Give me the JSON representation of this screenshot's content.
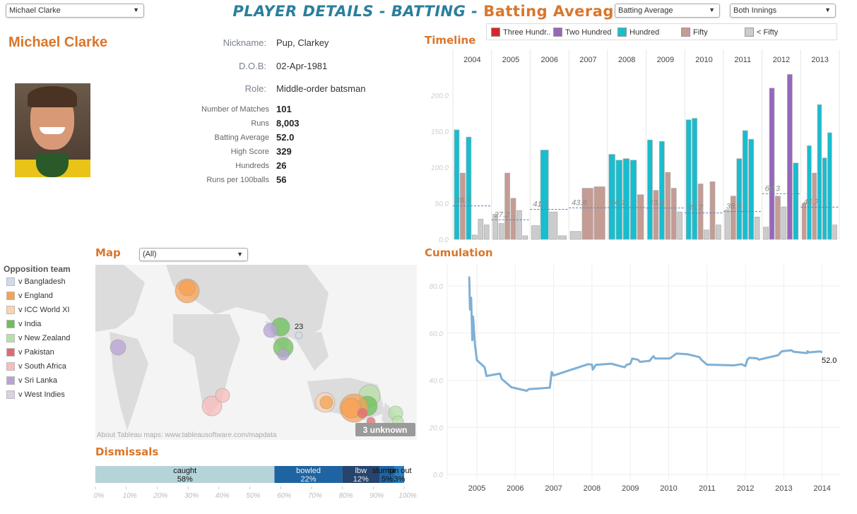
{
  "header": {
    "player_select": "Michael Clarke",
    "title_main": "PLAYER DETAILS - BATTING - ",
    "title_metric": "Batting Average",
    "metric_select": "Batting Average",
    "innings_select": "Both Innings"
  },
  "player": {
    "name": "Michael Clarke",
    "nickname_label": "Nickname:",
    "nickname": "Pup, Clarkey",
    "dob_label": "D.O.B:",
    "dob": "02-Apr-1981",
    "role_label": "Role:",
    "role": "Middle-order batsman",
    "stats": [
      {
        "label": "Number of Matches",
        "value": "101"
      },
      {
        "label": "Runs",
        "value": "8,003"
      },
      {
        "label": "Batting Average",
        "value": "52.0"
      },
      {
        "label": "High Score",
        "value": "329"
      },
      {
        "label": "Hundreds",
        "value": "26"
      },
      {
        "label": "Runs per 100balls",
        "value": "56"
      }
    ]
  },
  "timeline": {
    "title": "Timeline",
    "legend": [
      {
        "label": "Three Hundr..",
        "color": "#d62728"
      },
      {
        "label": "Two Hundred",
        "color": "#9467bd"
      },
      {
        "label": "Hundred",
        "color": "#17becf"
      },
      {
        "label": "Fifty",
        "color": "#c49c94"
      },
      {
        "label": "< Fifty",
        "color": "#cccccc"
      }
    ]
  },
  "map": {
    "title": "Map",
    "filter": "(All)",
    "attribution": "About Tableau maps: www.tableausoftware.com/mapdata",
    "unknown_badge": "3 unknown",
    "label_23": "23"
  },
  "opposition": {
    "title": "Opposition team",
    "items": [
      {
        "label": "v Bangladesh",
        "color": "#cfdcee"
      },
      {
        "label": "v England",
        "color": "#f8a153"
      },
      {
        "label": "v ICC World XI",
        "color": "#fcd3ab"
      },
      {
        "label": "v India",
        "color": "#6cbf5a"
      },
      {
        "label": "v New Zealand",
        "color": "#b7e2a7"
      },
      {
        "label": "v Pakistan",
        "color": "#e56870"
      },
      {
        "label": "v South Africa",
        "color": "#f9bcbc"
      },
      {
        "label": "v Sri Lanka",
        "color": "#b8a3d6"
      },
      {
        "label": "v West Indies",
        "color": "#dccfe6"
      }
    ]
  },
  "dismissals": {
    "title": "Dismissals"
  },
  "cumulation": {
    "title": "Cumulation"
  },
  "chart_data": [
    {
      "type": "bar",
      "title": "Timeline",
      "categories": [
        "2004",
        "2005",
        "2006",
        "2007",
        "2008",
        "2009",
        "2010",
        "2011",
        "2012",
        "2013"
      ],
      "yticks": [
        "0.0",
        "50.0",
        "100.0",
        "150.0",
        "200.0"
      ],
      "ylim": [
        0,
        230
      ],
      "innings": [
        [
          [
            "Hundred",
            152
          ],
          [
            "Fifty",
            92
          ],
          [
            "Hundred",
            142
          ],
          [
            "< Fifty",
            6
          ],
          [
            "< Fifty",
            28
          ],
          [
            "< Fifty",
            20
          ]
        ],
        [
          [
            "< Fifty",
            35
          ],
          [
            "< Fifty",
            22
          ],
          [
            "Fifty",
            92
          ],
          [
            "Fifty",
            57
          ],
          [
            "< Fifty",
            40
          ],
          [
            "< Fifty",
            5
          ]
        ],
        [
          [
            "< Fifty",
            19
          ],
          [
            "Hundred",
            124
          ],
          [
            "< Fifty",
            38
          ],
          [
            "< Fifty",
            5
          ]
        ],
        [
          [
            "< Fifty",
            11
          ],
          [
            "Fifty",
            71
          ],
          [
            "Fifty",
            73
          ]
        ],
        [
          [
            "Hundred",
            118
          ],
          [
            "Hundred",
            110
          ],
          [
            "Hundred",
            112
          ],
          [
            "Hundred",
            110
          ],
          [
            "Fifty",
            62
          ]
        ],
        [
          [
            "Hundred",
            138
          ],
          [
            "Fifty",
            68
          ],
          [
            "Hundred",
            136
          ],
          [
            "Fifty",
            93
          ],
          [
            "Fifty",
            71
          ],
          [
            "< Fifty",
            38
          ]
        ],
        [
          [
            "Hundred",
            166
          ],
          [
            "Hundred",
            168
          ],
          [
            "Fifty",
            77
          ],
          [
            "< Fifty",
            13
          ],
          [
            "Fifty",
            80
          ],
          [
            "< Fifty",
            20
          ]
        ],
        [
          [
            "< Fifty",
            41
          ],
          [
            "Fifty",
            60
          ],
          [
            "Hundred",
            112
          ],
          [
            "Hundred",
            151
          ],
          [
            "Hundred",
            139
          ],
          [
            "< Fifty",
            31
          ]
        ],
        [
          [
            "< Fifty",
            17
          ],
          [
            "Two Hundred",
            210
          ],
          [
            "Fifty",
            60
          ],
          [
            "< Fifty",
            45
          ],
          [
            "Two Hundred",
            229
          ],
          [
            "Hundred",
            106
          ]
        ],
        [
          [
            "Fifty",
            50
          ],
          [
            "Hundred",
            130
          ],
          [
            "Fifty",
            92
          ],
          [
            "Hundred",
            187
          ],
          [
            "Hundred",
            113
          ],
          [
            "Hundred",
            148
          ],
          [
            "< Fifty",
            20
          ]
        ]
      ],
      "averages": [
        "46.4",
        "27.2",
        "41.7",
        "43.8",
        "44.1",
        "43.5",
        "36.7",
        "38.6",
        "63.3",
        "44.7"
      ]
    },
    {
      "type": "bar",
      "title": "Dismissals",
      "orientation": "horizontal-stacked",
      "segments": [
        {
          "label": "caught",
          "pct": 58,
          "text": "58%",
          "color": "#b4d4da"
        },
        {
          "label": "bowled",
          "pct": 22,
          "text": "22%",
          "color": "#1f64a2"
        },
        {
          "label": "lbw",
          "pct": 12,
          "text": "12%",
          "color": "#26446d"
        },
        {
          "label": "stumped",
          "pct": 5,
          "text": "5%",
          "color": "#1f64a2"
        },
        {
          "label": "run out",
          "pct": 3,
          "text": "3%",
          "color": "#2a7fc0"
        }
      ],
      "xticks": [
        "0%",
        "10%",
        "20%",
        "30%",
        "40%",
        "50%",
        "60%",
        "70%",
        "80%",
        "90%",
        "100%"
      ]
    },
    {
      "type": "line",
      "title": "Cumulation",
      "yticks": [
        "0.0",
        "20.0",
        "40.0",
        "60.0",
        "80.0"
      ],
      "xticks": [
        "2005",
        "2006",
        "2007",
        "2008",
        "2009",
        "2010",
        "2011",
        "2012",
        "2013",
        "2014"
      ],
      "ylim": [
        0,
        88
      ],
      "xlim": [
        2004.3,
        2014.5
      ],
      "end_label": "52.0",
      "color": "#7fb0d6",
      "points": [
        [
          2004.8,
          84
        ],
        [
          2004.82,
          70
        ],
        [
          2004.85,
          75
        ],
        [
          2004.88,
          57
        ],
        [
          2004.9,
          67
        ],
        [
          2004.95,
          55
        ],
        [
          2005.0,
          48.5
        ],
        [
          2005.2,
          45.5
        ],
        [
          2005.25,
          41.8
        ],
        [
          2005.6,
          42.8
        ],
        [
          2005.65,
          40.5
        ],
        [
          2005.9,
          37
        ],
        [
          2006.3,
          35.5
        ],
        [
          2006.35,
          36.2
        ],
        [
          2006.9,
          36.8
        ],
        [
          2006.95,
          43.5
        ],
        [
          2007.0,
          42
        ],
        [
          2007.9,
          46.8
        ],
        [
          2008.0,
          46.6
        ],
        [
          2008.02,
          44.5
        ],
        [
          2008.1,
          46.5
        ],
        [
          2008.5,
          47
        ],
        [
          2008.85,
          45.5
        ],
        [
          2008.9,
          46.5
        ],
        [
          2009.0,
          47
        ],
        [
          2009.05,
          49.2
        ],
        [
          2009.2,
          48.7
        ],
        [
          2009.25,
          47.8
        ],
        [
          2009.5,
          48.2
        ],
        [
          2009.6,
          50.2
        ],
        [
          2009.65,
          49.2
        ],
        [
          2010.0,
          49.2
        ],
        [
          2010.05,
          49.5
        ],
        [
          2010.2,
          51.3
        ],
        [
          2010.5,
          51
        ],
        [
          2010.8,
          49.8
        ],
        [
          2010.85,
          48.7
        ],
        [
          2011.0,
          46.6
        ],
        [
          2011.7,
          46.3
        ],
        [
          2011.9,
          46.8
        ],
        [
          2012.0,
          46
        ],
        [
          2012.05,
          48.7
        ],
        [
          2012.1,
          49.5
        ],
        [
          2012.3,
          49.3
        ],
        [
          2012.35,
          48.7
        ],
        [
          2012.85,
          50.6
        ],
        [
          2012.95,
          52.3
        ],
        [
          2013.2,
          52.7
        ],
        [
          2013.25,
          52.1
        ],
        [
          2013.6,
          51.5
        ],
        [
          2013.62,
          52.3
        ],
        [
          2013.65,
          51.8
        ],
        [
          2013.95,
          52.2
        ],
        [
          2014.0,
          51.8
        ]
      ]
    }
  ]
}
